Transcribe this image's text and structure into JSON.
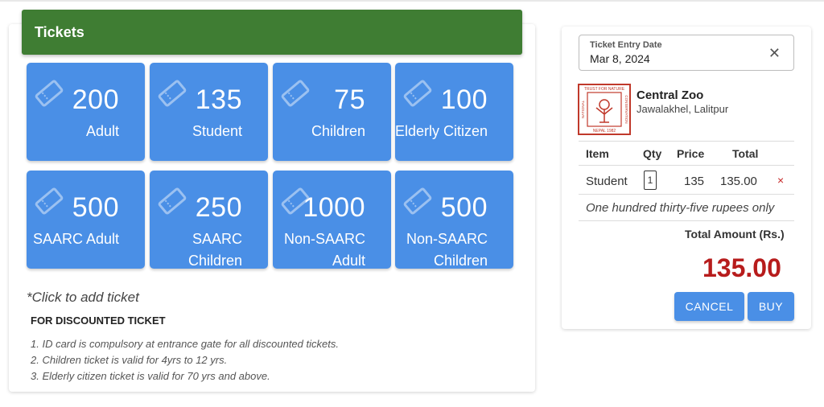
{
  "panel": {
    "title": "Tickets"
  },
  "tickets": [
    {
      "count": "200",
      "label": "Adult"
    },
    {
      "count": "135",
      "label": "Student"
    },
    {
      "count": "75",
      "label": "Children"
    },
    {
      "count": "100",
      "label": "Elderly Citizen"
    },
    {
      "count": "500",
      "label": "SAARC Adult"
    },
    {
      "count": "250",
      "label": "SAARC Children"
    },
    {
      "count": "1000",
      "label": "Non-SAARC Adult"
    },
    {
      "count": "500",
      "label": "Non-SAARC Children"
    }
  ],
  "notes": {
    "click_hint": "*Click to add ticket",
    "discount_title": "FOR DISCOUNTED TICKET",
    "items": [
      "1. ID card is compulsory at entrance gate for all discounted tickets.",
      "2. Children ticket is valid for 4yrs to 12 yrs.",
      "3. Elderly citizen ticket is valid for 70 yrs and above."
    ]
  },
  "entry_date": {
    "label": "Ticket Entry Date",
    "value": "Mar 8, 2024",
    "clear_icon": "close-icon"
  },
  "venue": {
    "name": "Central Zoo",
    "address": "Jawalakhel, Lalitpur",
    "logo_text": {
      "top": "TRUST FOR NATURE",
      "left": "NATIONAL",
      "right": "CONSERVATION",
      "bottom": "NEPAL 1982"
    }
  },
  "cart": {
    "headers": {
      "item": "Item",
      "qty": "Qty",
      "price": "Price",
      "total": "Total"
    },
    "rows": [
      {
        "item": "Student",
        "qty": "1",
        "price": "135",
        "total": "135.00",
        "remove": "×"
      }
    ],
    "amount_in_words": "One hundred thirty-five rupees only",
    "total_label": "Total Amount (Rs.)",
    "total_amount": "135.00"
  },
  "actions": {
    "cancel": "CANCEL",
    "buy": "BUY"
  },
  "colors": {
    "header_green": "#3f7d33",
    "tile_blue": "#4a8fe6",
    "total_red": "#b71c1c"
  }
}
